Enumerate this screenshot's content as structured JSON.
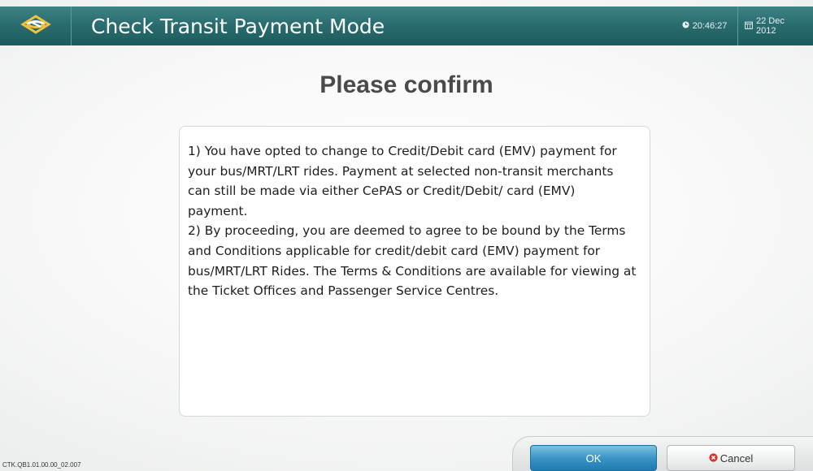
{
  "header": {
    "logo": "transit-logo-icon",
    "title": "Check Transit Payment Mode",
    "time": "20:46:27",
    "date": "22 Dec 2012",
    "time_icon": "clock-icon",
    "date_icon": "calendar-icon"
  },
  "main": {
    "heading": "Please confirm",
    "message": {
      "paragraph_1": "1) You have opted to change to Credit/Debit card (EMV) payment for your bus/MRT/LRT rides. Payment at selected non-transit merchants can still be made via either CePAS or Credit/Debit/ card (EMV) payment.",
      "paragraph_2": "2) By proceeding, you are deemed to agree to be bound by the Terms and Conditions applicable for credit/debit card (EMV) payment for bus/MRT/LRT Rides. The Terms & Conditions are available for viewing at the Ticket Offices and Passenger Service Centres."
    }
  },
  "footer": {
    "ok_label": "OK",
    "cancel_label": "Cancel",
    "cancel_icon": "cancel-x-icon",
    "version": "CTK.QB1.01.00.00_02.007"
  },
  "colors": {
    "header_bg": "#2a6d70",
    "ok_button": "#3a95c7",
    "cancel_icon": "#d9342b"
  }
}
